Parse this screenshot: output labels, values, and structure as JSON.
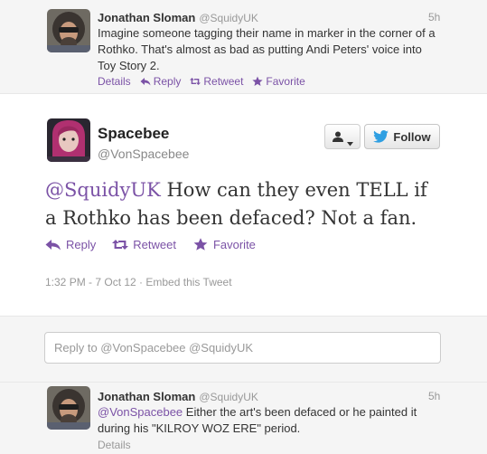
{
  "top_tweet": {
    "name": "Jonathan Sloman",
    "handle": "@SquidyUK",
    "time": "5h",
    "text": "Imagine someone tagging their name in marker in the corner of a Rothko. That's almost as bad as putting Andi Peters' voice into Toy Story 2.",
    "actions": {
      "details": "Details",
      "reply": "Reply",
      "retweet": "Retweet",
      "favorite": "Favorite"
    }
  },
  "main_tweet": {
    "name": "Spacebee",
    "handle": "@VonSpacebee",
    "follow_label": "Follow",
    "mention": "@SquidyUK",
    "text": " How can they even TELL if a Rothko has been defaced? Not a fan.",
    "actions": {
      "reply": "Reply",
      "retweet": "Retweet",
      "favorite": "Favorite"
    },
    "meta": "1:32 PM - 7 Oct 12 · Embed this Tweet"
  },
  "reply_box": {
    "placeholder": "Reply to @VonSpacebee @SquidyUK"
  },
  "bottom_tweet": {
    "name": "Jonathan Sloman",
    "handle": "@SquidyUK",
    "time": "5h",
    "mention": "@VonSpacebee",
    "text": " Either the art's been defaced or he painted it during his \"KILROY WOZ ERE\" period.",
    "details": "Details"
  },
  "colors": {
    "accent": "#7b52a6",
    "muted": "#999999",
    "twitter_blue": "#2f9fe2"
  }
}
